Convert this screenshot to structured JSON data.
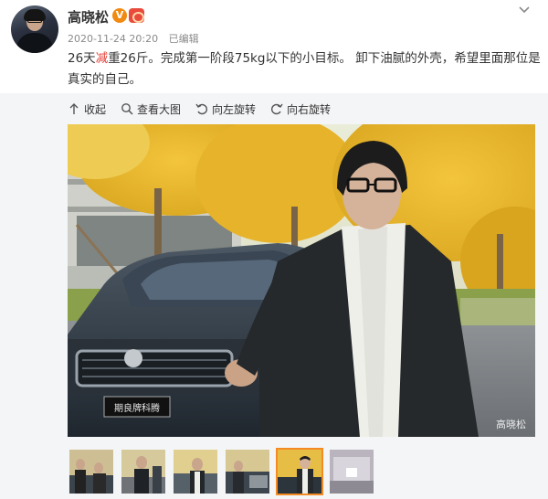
{
  "post": {
    "username": "高晓松",
    "verified_badge": "V",
    "timestamp": "2020-11-24 20:20",
    "edited_label": "已编辑",
    "text_parts": {
      "before": "26天",
      "highlight": "减",
      "after": "重26斤。完成第一阶段75kg以下的小目标。 卸下油腻的外壳，希望里面那位是真实的自己。"
    }
  },
  "toolbar": {
    "collapse": "收起",
    "view_large": "查看大图",
    "rotate_left": "向左旋转",
    "rotate_right": "向右旋转"
  },
  "photo": {
    "watermark": "高晓松",
    "car_plate": "期良牌科腾"
  },
  "thumbnails": {
    "count": 6,
    "active_index": 4
  },
  "colors": {
    "highlight_text": "#e23b33",
    "active_thumb_border": "#f48b22",
    "verified_badge": "#f08a11"
  }
}
